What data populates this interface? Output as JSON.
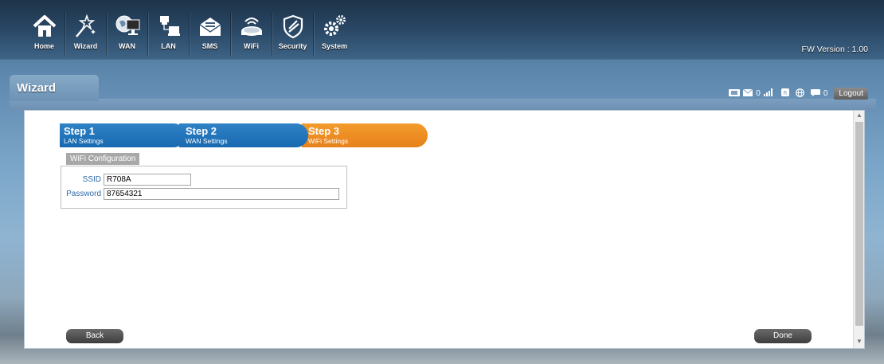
{
  "nav": {
    "items": [
      {
        "label": "Home",
        "icon": "home-icon"
      },
      {
        "label": "Wizard",
        "icon": "wizard-wand-icon"
      },
      {
        "label": "WAN",
        "icon": "wan-globe-icon"
      },
      {
        "label": "LAN",
        "icon": "lan-computers-icon"
      },
      {
        "label": "SMS",
        "icon": "sms-envelope-icon"
      },
      {
        "label": "WiFi",
        "icon": "wifi-router-icon"
      },
      {
        "label": "Security",
        "icon": "security-shield-icon"
      },
      {
        "label": "System",
        "icon": "system-gears-icon"
      }
    ]
  },
  "fw_version": "FW Version : 1.00",
  "page_title": "Wizard",
  "status": {
    "sms_count": "0",
    "message_count": "0",
    "logout_label": "Logout"
  },
  "steps": [
    {
      "title": "Step 1",
      "subtitle": "LAN Settings",
      "state": "completed"
    },
    {
      "title": "Step 2",
      "subtitle": "WAN Settings",
      "state": "completed"
    },
    {
      "title": "Step 3",
      "subtitle": "WiFi Settings",
      "state": "active"
    }
  ],
  "wifi_config": {
    "section_label": "WiFi Configuration",
    "ssid_label": "SSID",
    "ssid_value": "R708A",
    "password_label": "Password",
    "password_value": "87654321"
  },
  "buttons": {
    "back_label": "Back",
    "done_label": "Done"
  },
  "colors": {
    "step_blue": "#1869b0",
    "step_orange": "#e7811a",
    "label_blue": "#2e6aa8"
  }
}
